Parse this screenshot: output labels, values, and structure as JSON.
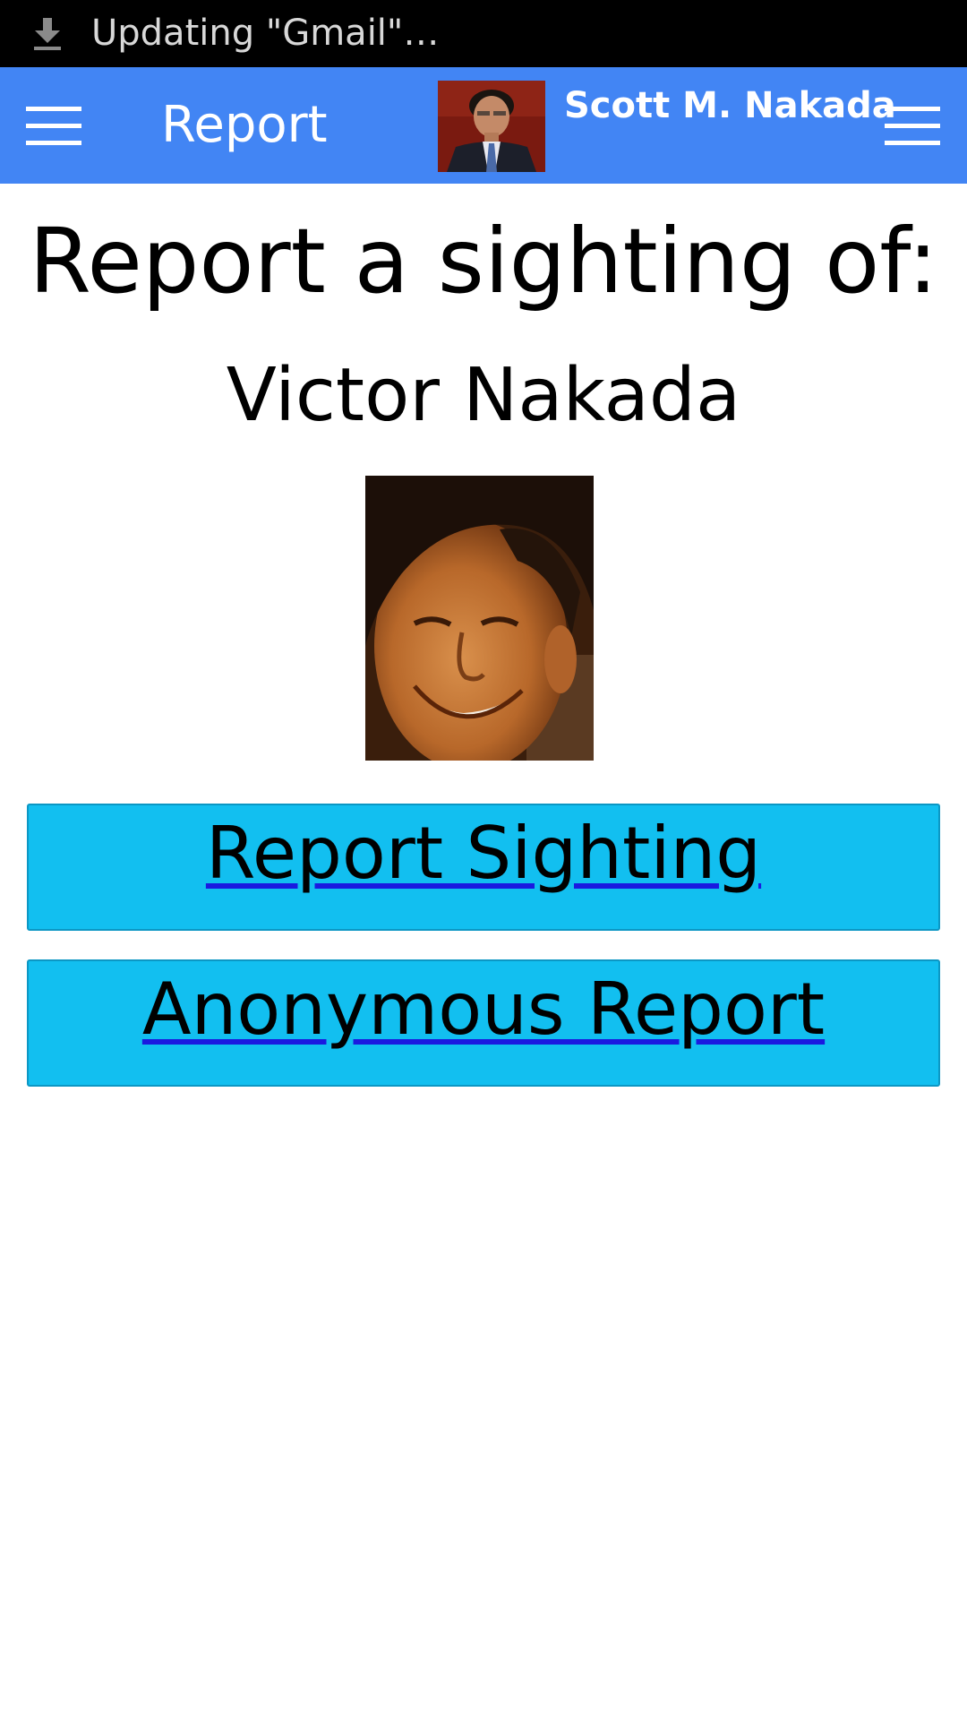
{
  "status_bar": {
    "notification_text": "Updating \"Gmail\"…",
    "icon": "download-icon"
  },
  "app_bar": {
    "title": "Report",
    "user_name": "Scott M. Nakada",
    "left_icon": "menu-icon",
    "right_icon": "menu-icon",
    "background_color": "#4285f4"
  },
  "content": {
    "heading": "Report a sighting of:",
    "person_name": "Victor Nakada",
    "buttons": {
      "report_sighting": "Report Sighting",
      "anonymous_report": "Anonymous Report"
    },
    "button_color": "#12bff0",
    "link_underline_color": "#1a1ae0"
  }
}
